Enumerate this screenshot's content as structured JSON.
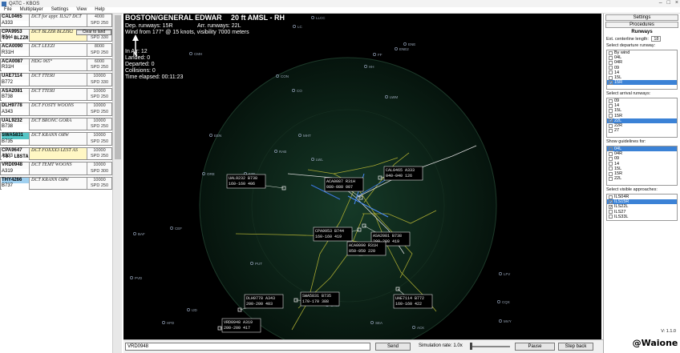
{
  "window": {
    "title": "QATC - KBOS",
    "controls": [
      "–",
      "□",
      "×"
    ]
  },
  "menu": [
    "File",
    "Multiplayer",
    "Settings",
    "View",
    "Help"
  ],
  "strips": [
    {
      "callsign": "CAL0465",
      "type": "A333",
      "route": "DCT for appr. ILS27 DCT",
      "alt1": "4000",
      "alt2": "SPD 250",
      "kind": "normal"
    },
    {
      "callsign": "CPA9953",
      "type": "B744",
      "route": "DCT BLZZR BLZZR2",
      "alt1": "10000",
      "alt2": "SPD 330",
      "to": "TO: BLZZR",
      "clear": "Clear to land",
      "kind": "yellow"
    },
    {
      "callsign": "ACA0090",
      "type": "R31H",
      "route": "DCT LEEZI",
      "alt1": "8000",
      "alt2": "SPD 250",
      "kind": "normal"
    },
    {
      "callsign": "ACA0087",
      "type": "R31H",
      "route": "HDG 065°",
      "alt1": "6000",
      "alt2": "SPD 250",
      "kind": "normal"
    },
    {
      "callsign": "UAE7114",
      "type": "B772",
      "route": "DCT TTERI",
      "alt1": "10000",
      "alt2": "SPD 330",
      "kind": "normal"
    },
    {
      "callsign": "ASA2081",
      "type": "B738",
      "route": "DCT TTERI",
      "alt1": "10000",
      "alt2": "SPD 250",
      "kind": "normal"
    },
    {
      "callsign": "DLH9778",
      "type": "A343",
      "route": "DCT FOSTY WOONS",
      "alt1": "10000",
      "alt2": "SPD 250",
      "kind": "normal"
    },
    {
      "callsign": "UAL9232",
      "type": "B738",
      "route": "DCT BRONC GORA",
      "alt1": "10000",
      "alt2": "SPD 250",
      "kind": "normal"
    },
    {
      "callsign": "SWA5831",
      "type": "B735",
      "route": "DCT KRANN ORW",
      "alt1": "10000",
      "alt2": "SPD 250",
      "kind": "hl"
    },
    {
      "callsign": "CPA9647",
      "type": "A333",
      "route": "DCT FOXXX3 LEST AS",
      "alt1": "10000",
      "alt2": "SPD 250",
      "to": "TO: LBSTA",
      "kind": "yellow"
    },
    {
      "callsign": "VRD0948",
      "type": "A319",
      "route": "DCT TEMT WOONS",
      "alt1": "10000",
      "alt2": "SPD 300",
      "kind": "normal"
    },
    {
      "callsign": "THY4266",
      "type": "B737",
      "route": "DCT KRANN ORW",
      "alt1": "10000",
      "alt2": "SPD 250",
      "kind": "hl2"
    }
  ],
  "radar": {
    "airport": "BOSTON/GENERAL EDWAR",
    "elevation": "20 ft AMSL - RH",
    "dep_runways": "Dep. runways: 15R",
    "arr_runways": "Arr. runways: 22L",
    "wind": "Wind from 177° @ 15 knots, visibility 7000 meters",
    "in_air": "In Air: 12",
    "landed": "Landed: 0",
    "departed": "Departed: 0",
    "collisions": "Collisions: 0",
    "elapsed": "Time elapsed: 00:11:23",
    "north": "N",
    "fixes": [
      {
        "name": "LLCC"
      },
      {
        "name": "LC"
      },
      {
        "name": "ENE"
      },
      {
        "name": "FF"
      },
      {
        "name": "HH"
      },
      {
        "name": "CMH"
      },
      {
        "name": "CON"
      },
      {
        "name": "CO"
      },
      {
        "name": "LWM"
      },
      {
        "name": "EEN"
      },
      {
        "name": "ORE"
      },
      {
        "name": "FZT"
      },
      {
        "name": "BAF"
      },
      {
        "name": "CEF"
      },
      {
        "name": "PVD"
      },
      {
        "name": "PUT"
      },
      {
        "name": "ORW"
      },
      {
        "name": "HFD"
      },
      {
        "name": "IJD"
      },
      {
        "name": "ENE2"
      },
      {
        "name": "MVY"
      },
      {
        "name": "CQX"
      },
      {
        "name": "ACK"
      },
      {
        "name": "LFV"
      },
      {
        "name": "SEA"
      },
      {
        "name": "LWL"
      },
      {
        "name": "MHT"
      },
      {
        "name": "RAB"
      }
    ],
    "tags": [
      {
        "cs": "UAL9232",
        "d1": "B738",
        "d2": "160-160",
        "d3": "406"
      },
      {
        "cs": "ACA0087",
        "d1": "R31H",
        "d2": "080-080",
        "d3": "007"
      },
      {
        "cs": "CAL0465",
        "d1": "A333",
        "d2": "040-040",
        "d3": "126"
      },
      {
        "cs": "CPA9953",
        "d1": "B744",
        "d2": "160-160",
        "d3": "419"
      },
      {
        "cs": "ASA2081",
        "d1": "B738",
        "d2": "200-200",
        "d3": "419"
      },
      {
        "cs": "ACA0090",
        "d1": "R31H",
        "d2": "050-050",
        "d3": "220"
      },
      {
        "cs": "DLH9778",
        "d1": "A343",
        "d2": "200-200",
        "d3": "403"
      },
      {
        "cs": "SWA5831",
        "d1": "B735",
        "d2": "170-170",
        "d3": "388"
      },
      {
        "cs": "UAE7114",
        "d1": "B772",
        "d2": "160-160",
        "d3": "422"
      },
      {
        "cs": "VRD0948",
        "d1": "A319",
        "d2": "200-200",
        "d3": "417"
      }
    ]
  },
  "bottom": {
    "command": "VRD0948",
    "send": "Send",
    "sim_rate": "Simulation rate: 1.0x",
    "pause": "Pause",
    "step_back": "Step back"
  },
  "right": {
    "tabs": [
      "Settings",
      "Procedures"
    ],
    "heading": "Runways",
    "ext_cl": "Ext. centerline length:",
    "ext_cl_val": "18",
    "dep_label": "Select departure runway:",
    "dep_list": [
      {
        "name": "By wind",
        "checked": false,
        "sel": false
      },
      {
        "name": "04L",
        "checked": false,
        "sel": false
      },
      {
        "name": "04R",
        "checked": false,
        "sel": false
      },
      {
        "name": "09",
        "checked": false,
        "sel": false
      },
      {
        "name": "14",
        "checked": false,
        "sel": false
      },
      {
        "name": "15L",
        "checked": false,
        "sel": false
      },
      {
        "name": "15R",
        "checked": true,
        "sel": true
      }
    ],
    "arr_label": "Select arrival runways:",
    "arr_list": [
      {
        "name": "09",
        "checked": false,
        "sel": false
      },
      {
        "name": "14",
        "checked": false,
        "sel": false
      },
      {
        "name": "15L",
        "checked": false,
        "sel": false
      },
      {
        "name": "15R",
        "checked": false,
        "sel": false
      },
      {
        "name": "22L",
        "checked": true,
        "sel": true
      },
      {
        "name": "22R",
        "checked": false,
        "sel": false
      },
      {
        "name": "27",
        "checked": false,
        "sel": false
      }
    ],
    "guide_label": "Show guidelines for:",
    "guide_list": [
      {
        "name": "04L",
        "checked": false,
        "sel": true
      },
      {
        "name": "04R",
        "checked": false,
        "sel": false
      },
      {
        "name": "09",
        "checked": false,
        "sel": false
      },
      {
        "name": "14",
        "checked": false,
        "sel": false
      },
      {
        "name": "15L",
        "checked": false,
        "sel": false
      },
      {
        "name": "15R",
        "checked": false,
        "sel": false
      },
      {
        "name": "22L",
        "checked": false,
        "sel": false
      }
    ],
    "app_label": "Select visible approaches:",
    "app_list": [
      {
        "name": "ILS04R",
        "checked": false,
        "sel": false
      },
      {
        "name": "ILS15R",
        "checked": true,
        "sel": true
      },
      {
        "name": "ILS22L",
        "checked": true,
        "sel": false
      },
      {
        "name": "ILS27",
        "checked": false,
        "sel": false
      },
      {
        "name": "ILS33L",
        "checked": false,
        "sel": false
      }
    ],
    "version": "V: 1.1.0"
  },
  "watermark": "@Waione",
  "colors": {
    "radar_bg": "#000000",
    "scope": "#0f2a1c",
    "fix": "#9aa7b8",
    "tag": "#e8e8e8",
    "route": "#c8c832",
    "accent": "#3b82d6"
  }
}
